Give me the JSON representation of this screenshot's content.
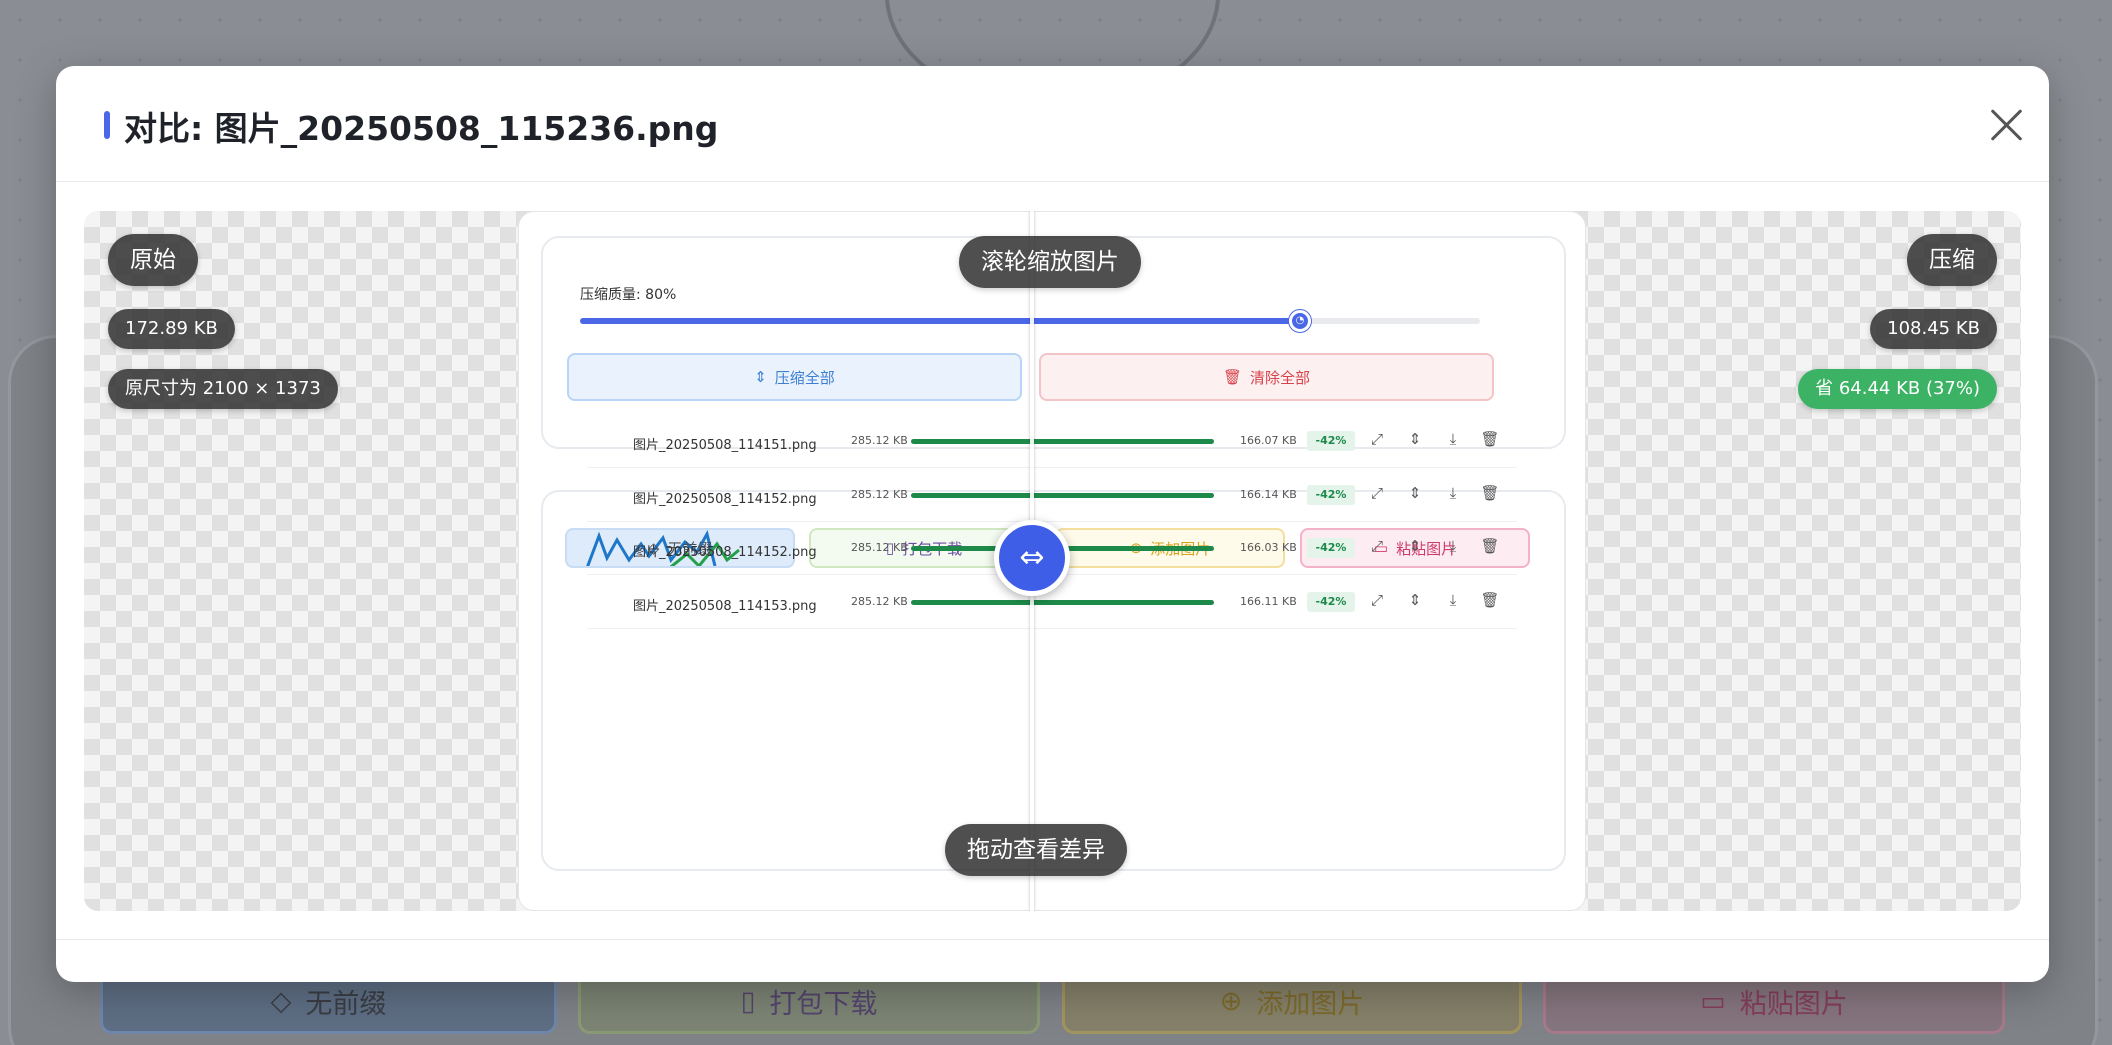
{
  "modal": {
    "title": "对比: 图片_20250508_115236.png"
  },
  "compare": {
    "left_label": "原始",
    "left_size": "172.89 KB",
    "left_dims": "原尺寸为 2100 × 1373",
    "right_label": "压缩",
    "right_size": "108.45 KB",
    "right_saved": "省 64.44 KB (37%)",
    "hint_top": "滚轮缩放图片",
    "hint_bottom": "拖动查看差异"
  },
  "shot": {
    "quality_label": "压缩质量: 80%",
    "quality_value": 0.8,
    "compress_all": "压缩全部",
    "clear_all": "清除全部",
    "action_buttons": [
      "无前缀",
      "打包下载",
      "添加图片",
      "粘贴图片"
    ],
    "files": [
      {
        "name": "图片_20250508_114151.png",
        "orig": "285.12 KB",
        "comp": "166.07 KB",
        "pct": "-42%",
        "progress": 1
      },
      {
        "name": "图片_20250508_114152.png",
        "orig": "285.12 KB",
        "comp": "166.14 KB",
        "pct": "-42%",
        "progress": 1
      },
      {
        "name": "图片_20250508_114152.png",
        "orig": "285.12 KB",
        "comp": "166.03 KB",
        "pct": "-42%",
        "progress": 1
      },
      {
        "name": "图片_20250508_114153.png",
        "orig": "285.12 KB",
        "comp": "166.11 KB",
        "pct": "-42%",
        "progress": 1
      }
    ]
  },
  "background": {
    "buttons": [
      "无前缀",
      "打包下载",
      "添加图片",
      "粘贴图片"
    ]
  },
  "colors": {
    "accent": "#4a67e8",
    "success": "#3cb264",
    "danger": "#d6434b"
  }
}
